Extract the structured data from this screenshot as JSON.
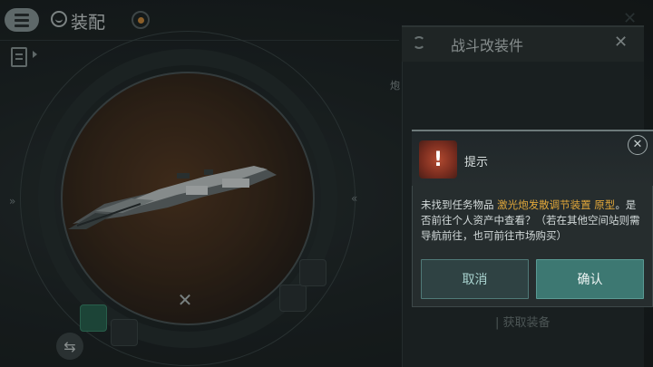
{
  "header": {
    "menu_icon": "menu-icon",
    "title_icon": "user-circle-icon",
    "title": "装配",
    "target_icon": "target-icon"
  },
  "hangar": {
    "clipboard_icon": "clipboard-icon",
    "left_marker": "»",
    "right_marker": "«",
    "close_glyph": "✕",
    "swap_icon": "swap-icon"
  },
  "side_panel": {
    "header_icon": "refresh-icon",
    "title": "战斗改装件",
    "close_glyph": "✕",
    "side_mark": "炮",
    "get_equipment": "| 获取装备"
  },
  "dialog": {
    "alert_icon": "exclamation-icon",
    "alert_glyph": "!",
    "title": "提示",
    "close_glyph": "✕",
    "message_prefix": "未找到任务物品 ",
    "message_item": "激光炮发散调节装置 原型",
    "message_suffix": "。是否前往个人资产中查看？（若在其他空间站则需导航前往，也可前往市场购买）",
    "cancel_label": "取消",
    "confirm_label": "确认"
  },
  "colors": {
    "accent": "#3d7872",
    "highlight": "#e1a73a",
    "alert": "#b24a30"
  }
}
